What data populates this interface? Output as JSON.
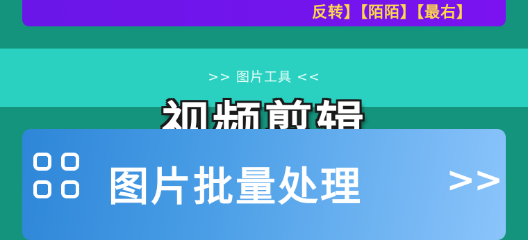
{
  "top_card": {
    "text": "反转】【陌陌】【最右】"
  },
  "section": {
    "subtitle": ">> 图片工具 <<"
  },
  "overlay": {
    "title": "视频剪辑"
  },
  "tool_card": {
    "label": "图片批量处理",
    "arrow": ">>",
    "icon": "grid-icon"
  }
}
